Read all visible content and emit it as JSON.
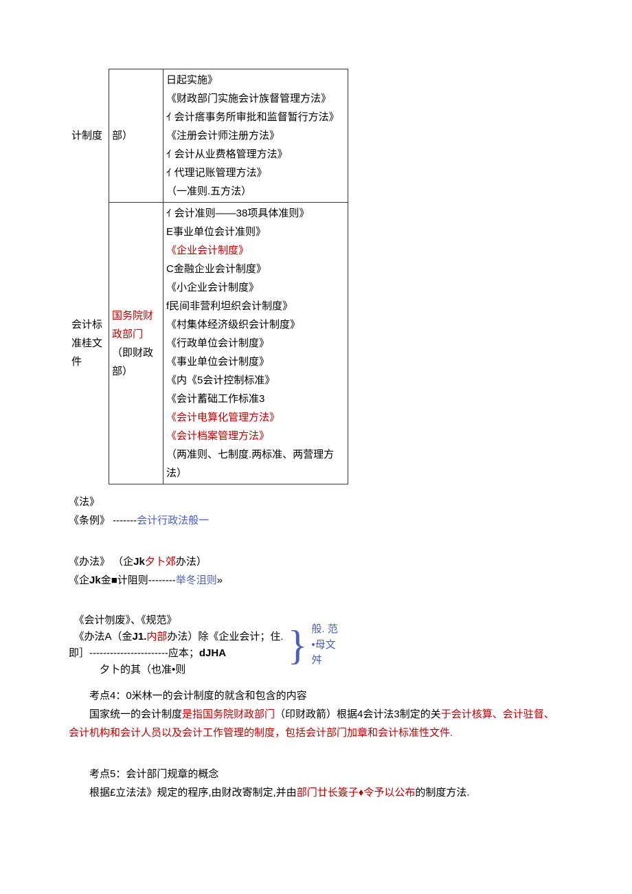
{
  "table": {
    "col1_row1": "计制度",
    "col1_row2": "会计标准桂文件",
    "col2_row1": "部）",
    "col2_row2_a": "国务院财政部门",
    "col2_row2_b": "（即财政部）",
    "col3_row1": {
      "lines": [
        "日起实施》",
        "《财政部门实施会计族督管理方法》",
        "ｲ 会计瘩事务所审批和监督暂行方法》",
        "《注册会计师注册方法》",
        "ｲ 会计从业费格管理方法》",
        "ｲ 代理记账管理方法》",
        "（一准则.五方法）"
      ]
    },
    "col3_row2": {
      "lines": [
        "ｲ 会计准则——38项具体准则》",
        "E事业单位会计准则》",
        {
          "text": "《企业会计制度》",
          "red": true
        },
        "C金融企业会计制度》",
        "《小企业会计制度》",
        "f民间非营利坦织会计制度》",
        "《村集体经济级织会计制度》",
        "《行政单位会计制度》",
        "《事业单位会计制度》",
        "《内《5会计控制标准》",
        "《会计蓄础工作标准3",
        {
          "text": "《会计电算化管理方法》",
          "red": true
        },
        {
          "text": "《会计档案管理方法》",
          "red": true
        },
        "（两准则、七制度.两标准、两营理方法）"
      ]
    }
  },
  "para1": {
    "line1": "《法》",
    "line2_a": "《条例》 -------",
    "line2_b": "会计行政法般一"
  },
  "para2": {
    "line1_a": "《办法》 （企",
    "line1_b": "Jk",
    "line1_c": "夕卜郊",
    "line1_d": "办法）",
    "line2_a": "《企",
    "line2_b": "Jk",
    "line2_c": "金■计阻则--------",
    "line2_d": "举冬沮则",
    "line2_e": "»"
  },
  "annotation": {
    "left": {
      "line1": "《会计刎废》、《规范》",
      "line2_a": "《办法A（金",
      "line2_b": "J1.",
      "line2_c": "内部",
      "line2_d": "办法）除《企业会计；住.",
      "line3_a": "即］-----------------------应本；",
      "line3_b": "dJHA",
      "line4": "夕卜的其（也准•则"
    },
    "right": {
      "line1": "般. 范",
      "line2": "•母文",
      "line3": "舛"
    }
  },
  "point4": {
    "title": "考点4：0米林一的会计制度的就含和包含的内容",
    "body_a": "国家统一的会计制度",
    "body_b": "是指国务院财政部门",
    "body_c": "（印财政箭）根据4会计法3制定的关",
    "body_d": "于会计核算、会计驻督、会计机构和会计人员以及会计工作管理的制度，包括会计部门加章和会计标准性文件."
  },
  "point5": {
    "title": "考点5：会计部门规章的概念",
    "body_a": "根据£立法法》规定的程序,由财改寄制定,并由",
    "body_b": "部门廿长簽子♦令予以公布",
    "body_c": "的制度方法."
  }
}
